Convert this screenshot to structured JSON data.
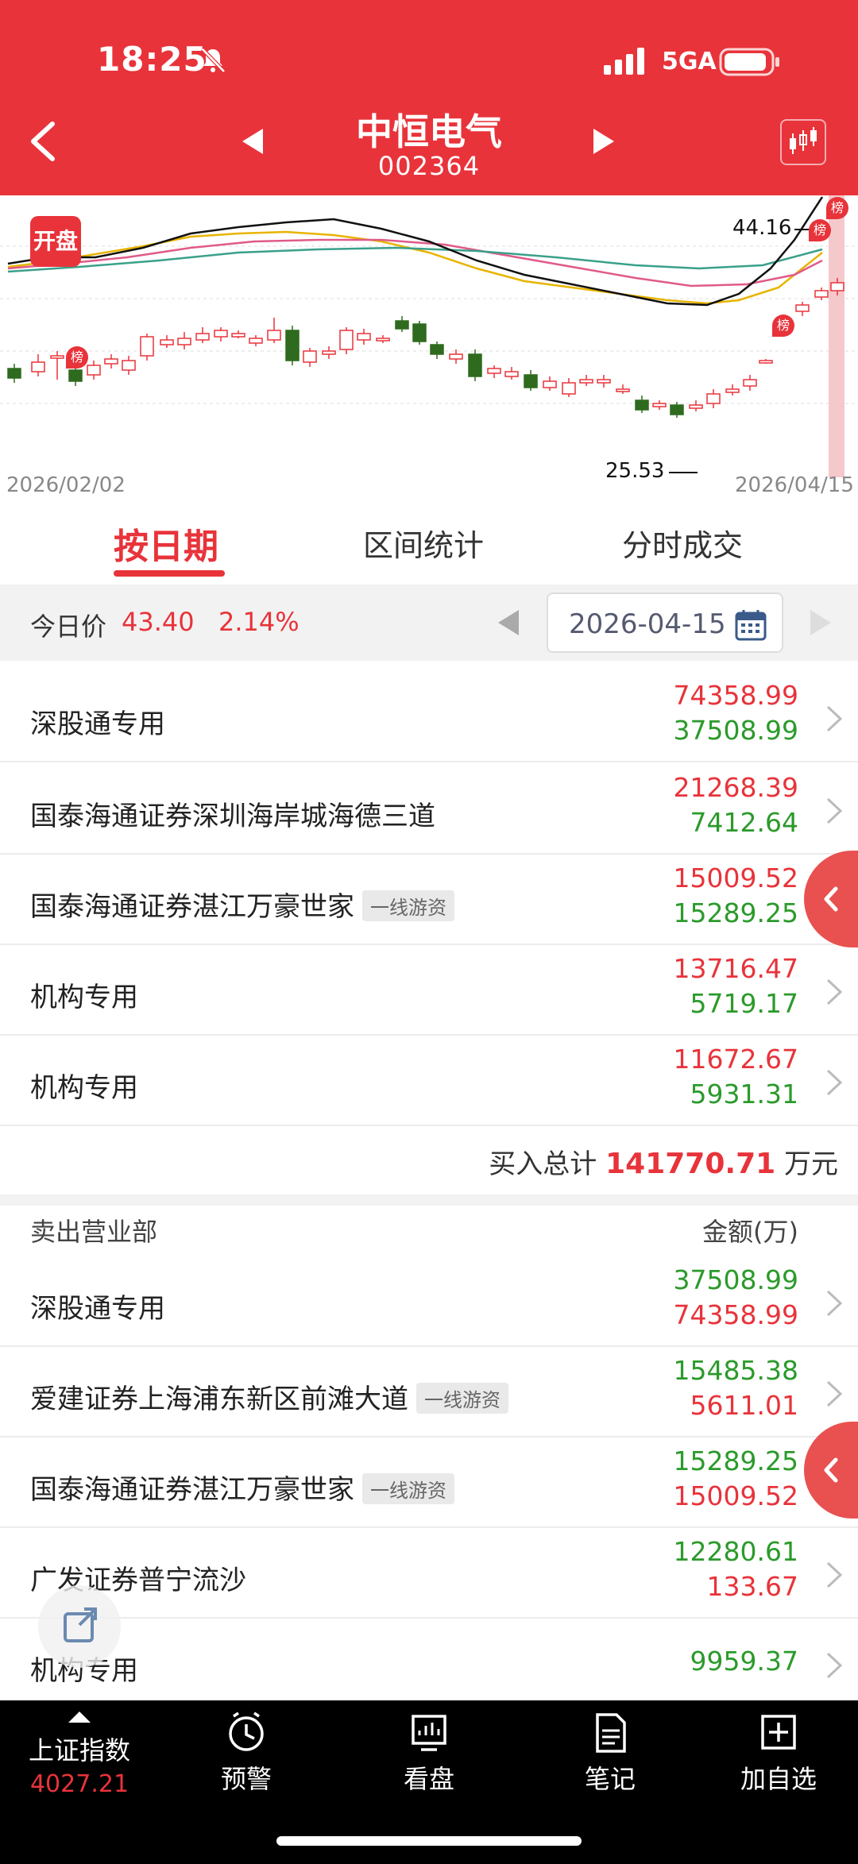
{
  "status_bar": {
    "time": "18:25",
    "network": "5GA"
  },
  "header": {
    "stock_name": "中恒电气",
    "stock_code": "002364"
  },
  "chart": {
    "badge": "开盘",
    "high_label": "44.16",
    "low_label": "25.53",
    "start_date": "2026/02/02",
    "end_date": "2026/04/15",
    "marker": "榜"
  },
  "tabs": [
    {
      "label": "按日期",
      "active": true
    },
    {
      "label": "区间统计",
      "active": false
    },
    {
      "label": "分时成交",
      "active": false
    }
  ],
  "price_bar": {
    "label": "今日价",
    "price": "43.40",
    "change": "2.14%",
    "date": "2026-04-15"
  },
  "buy_rows": [
    {
      "name": "深股通专用",
      "tag": "",
      "buy": "74358.99",
      "sell": "37508.99"
    },
    {
      "name": "国泰海通证券深圳海岸城海德三道",
      "tag": "",
      "buy": "21268.39",
      "sell": "7412.64"
    },
    {
      "name": "国泰海通证券湛江万豪世家",
      "tag": "一线游资",
      "buy": "15009.52",
      "sell": "15289.25"
    },
    {
      "name": "机构专用",
      "tag": "",
      "buy": "13716.47",
      "sell": "5719.17"
    },
    {
      "name": "机构专用",
      "tag": "",
      "buy": "11672.67",
      "sell": "5931.31"
    }
  ],
  "buy_total": {
    "label": "买入总计",
    "value": "141770.71",
    "unit": "万元"
  },
  "sell_header": {
    "title": "卖出营业部",
    "amount": "金额(万)"
  },
  "sell_rows": [
    {
      "name": "深股通专用",
      "tag": "",
      "sell": "37508.99",
      "buy": "74358.99"
    },
    {
      "name": "爱建证券上海浦东新区前滩大道",
      "tag": "一线游资",
      "sell": "15485.38",
      "buy": "5611.01"
    },
    {
      "name": "国泰海通证券湛江万豪世家",
      "tag": "一线游资",
      "sell": "15289.25",
      "buy": "15009.52"
    },
    {
      "name": "广发证券普宁流沙",
      "tag": "",
      "sell": "12280.61",
      "buy": "133.67"
    },
    {
      "name": "机构专用",
      "tag": "",
      "sell": "9959.37",
      "buy": ""
    }
  ],
  "tabbar": {
    "index_name": "上证指数",
    "index_value": "4027.21",
    "items": [
      "预警",
      "看盘",
      "笔记",
      "加自选"
    ]
  },
  "colors": {
    "brand_red": "#e8333a",
    "down_green": "#2b9a2b",
    "candle_green": "#2e6b1e"
  }
}
